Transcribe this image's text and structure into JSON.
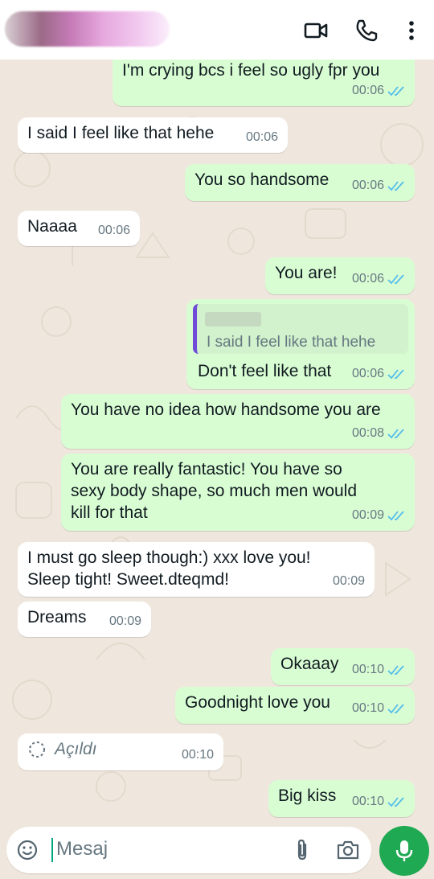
{
  "header": {
    "contact_name_hidden": ""
  },
  "messages": [
    {
      "id": "m1",
      "dir": "out",
      "text": "I'm crying bcs i feel so ugly fpr you",
      "time": "00:06",
      "read": true
    },
    {
      "id": "m2",
      "dir": "in",
      "text": "I said I feel like that hehe",
      "time": "00:06"
    },
    {
      "id": "m3",
      "dir": "out",
      "text": "You so handsome",
      "time": "00:06",
      "read": true
    },
    {
      "id": "m4",
      "dir": "in",
      "text": "Naaaa",
      "time": "00:06"
    },
    {
      "id": "m5",
      "dir": "out",
      "text": "You are!",
      "time": "00:06",
      "read": true
    },
    {
      "id": "m6",
      "dir": "out",
      "quoted": "I said I feel like that hehe",
      "text": "Don't feel like that",
      "time": "00:06",
      "read": true
    },
    {
      "id": "m7",
      "dir": "out",
      "text": "You have no idea how handsome you are",
      "time": "00:08",
      "read": true
    },
    {
      "id": "m8",
      "dir": "out",
      "lines": [
        "You are really fantastic! You have so",
        "sexy body shape, so much men would",
        "kill for that"
      ],
      "time": "00:09",
      "read": true
    },
    {
      "id": "m9",
      "dir": "in",
      "lines": [
        "I must go sleep though:) xxx love you!",
        "Sleep tight! Sweet.dteqmd!"
      ],
      "time": "00:09"
    },
    {
      "id": "m10",
      "dir": "in",
      "text": "Dreams",
      "time": "00:09"
    },
    {
      "id": "m11",
      "dir": "out",
      "text": "Okaaay",
      "time": "00:10",
      "read": true
    },
    {
      "id": "m12",
      "dir": "out",
      "text": "Goodnight love you",
      "time": "00:10",
      "read": true
    },
    {
      "id": "m13",
      "dir": "in",
      "text": "Açıldı",
      "time": "00:10",
      "view_once_opened": true
    },
    {
      "id": "m14",
      "dir": "out",
      "text": "Big kiss",
      "time": "00:10",
      "read": true
    }
  ],
  "composer": {
    "placeholder": "Mesaj"
  },
  "icons": {
    "video_call": "video-camera-icon",
    "voice_call": "phone-icon",
    "menu": "more-vertical-icon",
    "emoji": "emoji-icon",
    "attach": "paperclip-icon",
    "camera": "camera-icon",
    "mic": "microphone-icon"
  },
  "colors": {
    "outgoing_bubble": "#d9fdd3",
    "incoming_bubble": "#ffffff",
    "read_ticks": "#53bdeb",
    "mic_button": "#1ea952",
    "chat_background": "#efe7dd"
  }
}
